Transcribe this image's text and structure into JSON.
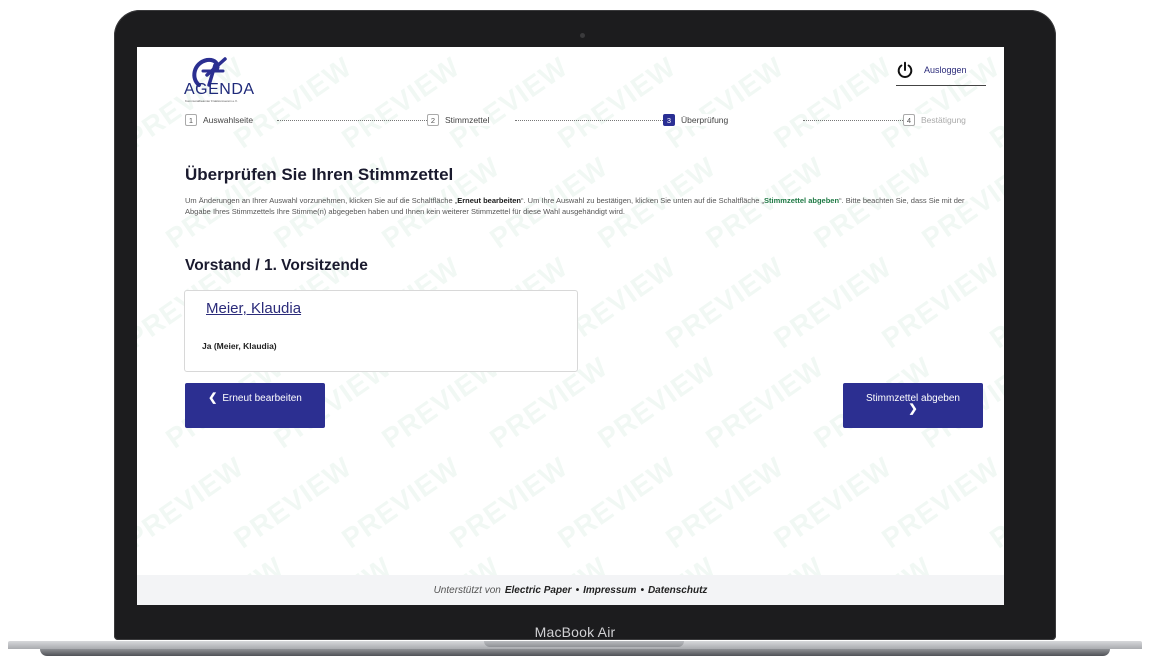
{
  "device": {
    "label": "MacBook Air"
  },
  "header": {
    "logo_text": "AGENDA",
    "logo_subtext": "Kommunalbeamter Fraktionsverein e.V.",
    "logout_label": "Ausloggen"
  },
  "steps": [
    {
      "num": "1",
      "label": "Auswahlseite",
      "state": "done"
    },
    {
      "num": "2",
      "label": "Stimmzettel",
      "state": "done"
    },
    {
      "num": "3",
      "label": "Überprüfung",
      "state": "active"
    },
    {
      "num": "4",
      "label": "Bestätigung",
      "state": "upcoming"
    }
  ],
  "main": {
    "title": "Überprüfen Sie Ihren Stimmzettel",
    "desc_part1": "Um Änderungen an Ihrer Auswahl vorzunehmen, klicken Sie auf die Schaltfläche „",
    "desc_bold1": "Erneut bearbeiten",
    "desc_part2": "“. Um Ihre Auswahl zu bestätigen, klicken Sie unten auf die Schaltfläche „",
    "desc_bold2": "Stimmzettel abgeben",
    "desc_part3": "“. Bitte beachten Sie, dass Sie mit der Abgabe Ihres Stimmzettels Ihre Stimme(n) abgegeben haben und Ihnen kein weiterer Stimmzettel für diese Wahl ausgehändigt wird.",
    "section_title": "Vorstand / 1. Vorsitzende",
    "candidate_name": "Meier, Klaudia",
    "candidate_choice": "Ja (Meier, Klaudia)"
  },
  "buttons": {
    "edit_label": "Erneut bearbeiten",
    "submit_label": "Stimmzettel abgeben"
  },
  "footer": {
    "prefix": "Unterstützt von",
    "brand": "Electric Paper",
    "sep1": "•",
    "impressum": "Impressum",
    "sep2": "•",
    "datenschutz": "Datenschutz"
  },
  "watermark": {
    "text": "PREVIEW"
  },
  "colors": {
    "primary": "#2c2f91",
    "accent_green": "#1f7a45",
    "watermark": "#148c46"
  }
}
